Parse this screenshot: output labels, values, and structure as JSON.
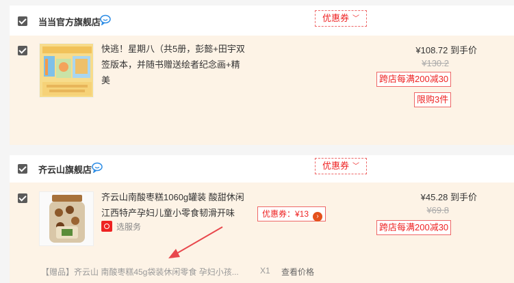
{
  "coupon_label": "优惠券",
  "shops": [
    {
      "name": "当当官方旗舰店",
      "item": {
        "title_line1": "快逃！星期八（共5册，彭懿+田宇双",
        "title_line2": "签版本，并随书赠送绘者纪念画+精美",
        "price": "¥108.72 到手价",
        "original_price": "¥130.2",
        "promo": "跨店每满200减30",
        "limit": "限购3件"
      }
    },
    {
      "name": "齐云山旗舰店",
      "item": {
        "title_line1": "齐云山南酸枣糕1060g罐装 酸甜休闲",
        "title_line2": "江西特产孕妇儿童小零食韧滑开味",
        "service": "选服务",
        "item_coupon": "优惠券：¥13",
        "price": "¥45.28 到手价",
        "original_price": "¥69.8",
        "promo": "跨店每满200减30",
        "gift": "【赠品】齐云山 南酸枣糕45g袋装休闲零食 孕妇小孩...",
        "gift_qty": "X1",
        "gift_price_link": "查看价格"
      }
    }
  ],
  "colors": {
    "accent_red": "#e22222",
    "item_bg": "#fdf3e6",
    "annotation_arrow": "#e8474c"
  }
}
